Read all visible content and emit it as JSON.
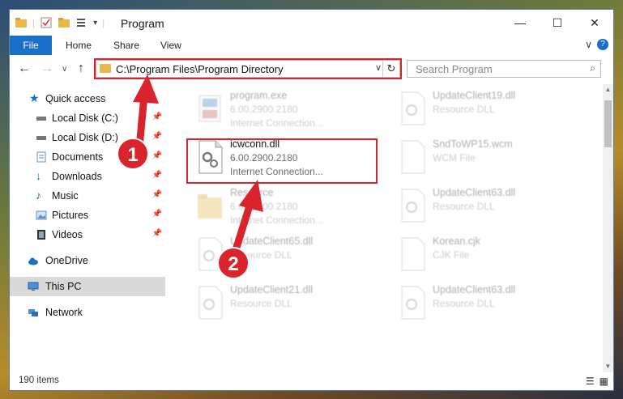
{
  "window": {
    "title": "Program"
  },
  "ribbon": {
    "tabs": [
      "File",
      "Home",
      "Share",
      "View"
    ]
  },
  "address": {
    "path": "C:\\Program Files\\Program Directory"
  },
  "search": {
    "placeholder": "Search Program"
  },
  "sidebar": {
    "items": [
      {
        "label": "Quick access",
        "icon": "star-icon"
      },
      {
        "label": "Local Disk (C:)",
        "icon": "drive-icon",
        "pinned": true
      },
      {
        "label": "Local Disk (D:)",
        "icon": "drive-icon",
        "pinned": true
      },
      {
        "label": "Documents",
        "icon": "documents-icon",
        "pinned": true
      },
      {
        "label": "Downloads",
        "icon": "download-icon",
        "pinned": true
      },
      {
        "label": "Music",
        "icon": "music-icon",
        "pinned": true
      },
      {
        "label": "Pictures",
        "icon": "pictures-icon",
        "pinned": true
      },
      {
        "label": "Videos",
        "icon": "videos-icon",
        "pinned": true
      },
      {
        "label": "OneDrive",
        "icon": "cloud-icon"
      },
      {
        "label": "This PC",
        "icon": "computer-icon",
        "selected": true
      },
      {
        "label": "Network",
        "icon": "network-icon"
      }
    ]
  },
  "files": [
    {
      "name": "program.exe",
      "line2": "6.00.2900.2180",
      "line3": "Internet Connection..."
    },
    {
      "name": "UpdateClient19.dll",
      "line2": "Resource DLL",
      "line3": ""
    },
    {
      "name": "icwconn.dll",
      "line2": "6.00.2900.2180",
      "line3": "Internet Connection...",
      "highlighted": true
    },
    {
      "name": "SndToWP15.wcm",
      "line2": "WCM File",
      "line3": ""
    },
    {
      "name": "Resource",
      "line2": "6.00.2900.2180",
      "line3": "Internet Connection..."
    },
    {
      "name": "UpdateClient63.dll",
      "line2": "Resource DLL",
      "line3": ""
    },
    {
      "name": "UpdateClient65.dll",
      "line2": "Resource DLL",
      "line3": ""
    },
    {
      "name": "Korean.cjk",
      "line2": "CJK File",
      "line3": ""
    },
    {
      "name": "UpdateClient21.dll",
      "line2": "Resource DLL",
      "line3": ""
    },
    {
      "name": "UpdateClient63.dll",
      "line2": "Resource DLL",
      "line3": ""
    }
  ],
  "status": {
    "count": "190 items"
  },
  "annotations": {
    "step1": "1",
    "step2": "2",
    "color": "#d9232d"
  },
  "colors": {
    "accent": "#1a6fc9",
    "highlight": "#d9232d",
    "selected_bg": "#d9d9d9"
  }
}
